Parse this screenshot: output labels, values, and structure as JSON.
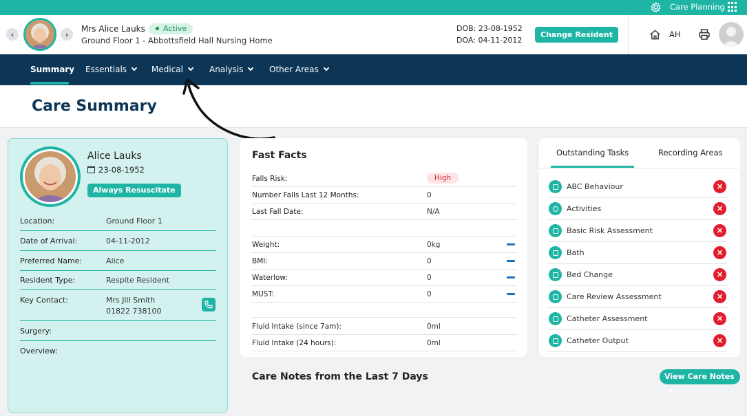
{
  "topbar": {
    "app_label": "Care Planning"
  },
  "resident": {
    "name": "Mrs Alice Lauks",
    "status": "Active",
    "location": "Ground Floor 1 - Abbottsfield Hall Nursing Home",
    "dob": "DOB: 23-08-1952",
    "doa": "DOA: 04-11-2012",
    "change_label": "Change Resident",
    "user_initials": "AH"
  },
  "nav": {
    "items": [
      {
        "label": "Summary"
      },
      {
        "label": "Essentials"
      },
      {
        "label": "Medical"
      },
      {
        "label": "Analysis"
      },
      {
        "label": "Other Areas"
      }
    ]
  },
  "page": {
    "title": "Care Summary"
  },
  "profile": {
    "name": "Alice Lauks",
    "dob": "23-08-1952",
    "resus": "Always Resuscitate",
    "rows": [
      {
        "key": "Location:",
        "value": "Ground Floor 1"
      },
      {
        "key": "Date of Arrival:",
        "value": "04-11-2012"
      },
      {
        "key": "Preferred Name:",
        "value": "Alice"
      },
      {
        "key": "Resident Type:",
        "value": "Respite Resident"
      },
      {
        "key": "Key Contact:",
        "value": "Mrs Jill Smith",
        "value2": "01822 738100"
      },
      {
        "key": "Surgery:",
        "value": ""
      },
      {
        "key": "Overview:",
        "value": ""
      }
    ]
  },
  "facts": {
    "title": "Fast Facts",
    "rows": [
      {
        "key": "Falls Risk:",
        "value": "High"
      },
      {
        "key": "Number Falls Last 12 Months:",
        "value": "0"
      },
      {
        "key": "Last Fall Date:",
        "value": "N/A"
      },
      {
        "key": "Weight:",
        "value": "0kg"
      },
      {
        "key": "BMI:",
        "value": "0"
      },
      {
        "key": "Waterlow:",
        "value": "0"
      },
      {
        "key": "MUST:",
        "value": "0"
      },
      {
        "key": "Fluid Intake (since 7am):",
        "value": "0ml"
      },
      {
        "key": "Fluid Intake (24 hours):",
        "value": "0ml"
      }
    ]
  },
  "tasks": {
    "tabs": [
      {
        "label": "Outstanding Tasks"
      },
      {
        "label": "Recording Areas"
      }
    ],
    "items": [
      {
        "label": "ABC Behaviour",
        "icon": "table-icon"
      },
      {
        "label": "Activities",
        "icon": "activity-icon"
      },
      {
        "label": "Basic Risk Assessment",
        "icon": "clipboard-icon"
      },
      {
        "label": "Bath",
        "icon": "bath-icon"
      },
      {
        "label": "Bed Change",
        "icon": "bed-icon"
      },
      {
        "label": "Care Review Assessment",
        "icon": "review-icon"
      },
      {
        "label": "Catheter Assessment",
        "icon": "clipboard-icon"
      },
      {
        "label": "Catheter Output",
        "icon": "catheter-icon"
      }
    ]
  },
  "notes": {
    "title": "Care Notes from the Last 7 Days",
    "view_label": "View Care Notes"
  }
}
